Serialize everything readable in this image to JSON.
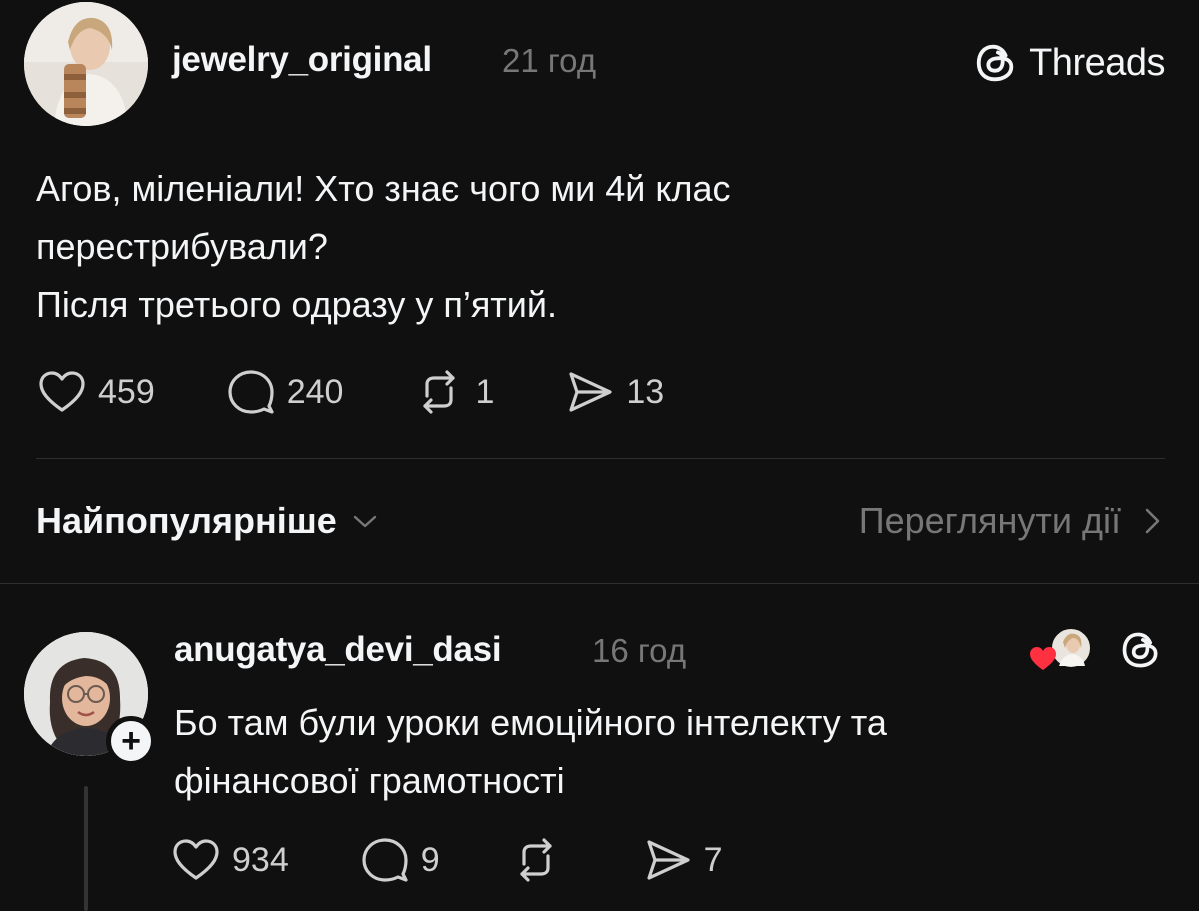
{
  "post": {
    "username": "jewelry_original",
    "time": "21 год",
    "lines": [
      "Агов, міленіали! Хто знає чого ми 4й клас",
      "перестрибували?",
      "Після третього одразу у п’ятий."
    ],
    "likes": "459",
    "comments": "240",
    "reposts": "1",
    "shares": "13"
  },
  "brand": {
    "name": "Threads"
  },
  "sort": {
    "label": "Найпопулярніше",
    "view_activity": "Переглянути дії"
  },
  "reply": {
    "username": "anugatya_devi_dasi",
    "time": "16 год",
    "follow_symbol": "+",
    "lines": [
      "Бо там були уроки емоційного інтелекту та",
      "фінансової грамотності"
    ],
    "likes": "934",
    "comments": "9",
    "reposts": "",
    "shares": "7"
  },
  "colors": {
    "background": "#101010",
    "text": "#f3f5f7",
    "muted": "#777777",
    "like_red": "#ff3040"
  }
}
